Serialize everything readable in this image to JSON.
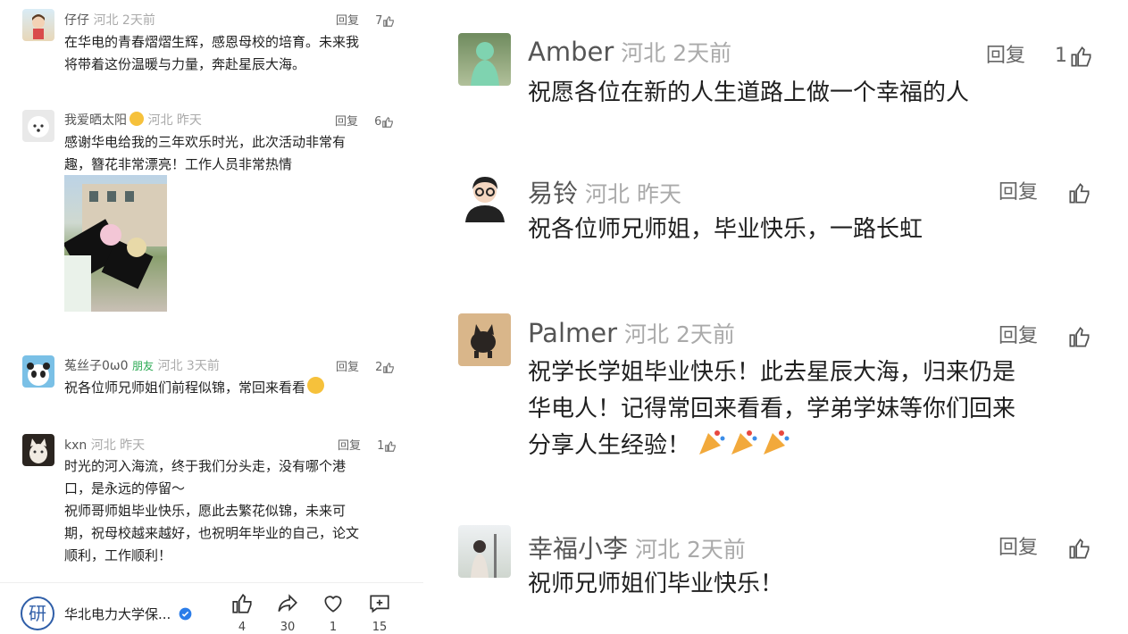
{
  "left": {
    "comments": [
      {
        "user": "仔仔",
        "loc": "河北",
        "time": "2天前",
        "reply": "回复",
        "likes": "7",
        "lines": [
          "在华电的青春熠熠生辉，感恩母校的培育。未来我",
          "将带着这份温暖与力量，奔赴星辰大海。"
        ]
      },
      {
        "user": "我爱晒太阳",
        "loc": "河北",
        "time": "昨天",
        "reply": "回复",
        "likes": "6",
        "lines": [
          "感谢华电给我的三年欢乐时光，此次活动非常有",
          "趣，簪花非常漂亮！工作人员非常热情"
        ]
      },
      {
        "user": "菟丝子0ω0",
        "tag": "朋友",
        "loc": "河北",
        "time": "3天前",
        "reply": "回复",
        "likes": "2",
        "lines": [
          "祝各位师兄师姐们前程似锦，常回来看看"
        ]
      },
      {
        "user": "kxn",
        "loc": "河北",
        "time": "昨天",
        "reply": "回复",
        "likes": "1",
        "lines": [
          "时光的河入海流，终于我们分头走，没有哪个港",
          "口，是永远的停留～",
          "祝师哥师姐毕业快乐，愿此去繁花似锦，未来可",
          "期，祝母校越来越好，也祝明年毕业的自己，论文",
          "顺利，工作顺利！"
        ]
      }
    ],
    "bottom": {
      "account": "华北电力大学保...",
      "logo_char": "研",
      "likes": "4",
      "shares": "30",
      "favs": "1",
      "comments": "15"
    }
  },
  "right": {
    "comments": [
      {
        "user": "Amber",
        "loc": "河北",
        "time": "2天前",
        "reply": "回复",
        "likes": "1",
        "lines": [
          "祝愿各位在新的人生道路上做一个幸福的人"
        ]
      },
      {
        "user": "易铃",
        "loc": "河北",
        "time": "昨天",
        "reply": "回复",
        "likes": "",
        "lines": [
          "祝各位师兄师姐，毕业快乐，一路长虹"
        ]
      },
      {
        "user": "Palmer",
        "loc": "河北",
        "time": "2天前",
        "reply": "回复",
        "likes": "",
        "lines": [
          "祝学长学姐毕业快乐！此去星辰大海，归来仍是",
          "华电人！记得常回来看看，学弟学妹等你们回来",
          "分享人生经验！"
        ]
      },
      {
        "user": "幸福小李",
        "loc": "河北",
        "time": "2天前",
        "reply": "回复",
        "likes": "",
        "lines": [
          "祝师兄师姐们毕业快乐！"
        ]
      }
    ]
  },
  "icons": {
    "like": "thumbs-up-icon",
    "share": "share-icon",
    "fav": "heart-icon",
    "comment": "comment-icon",
    "verified": "verified-badge-icon",
    "smile": "smile-emoji-icon",
    "think": "thinking-emoji-icon",
    "party": "party-popper-emoji-icon"
  },
  "colors": {
    "tag": "#2aa952",
    "verified": "#2b7de9",
    "muted": "#999999"
  }
}
